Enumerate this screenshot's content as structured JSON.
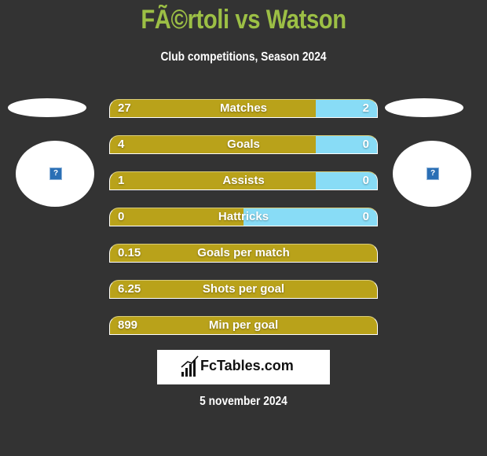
{
  "header": {
    "title": "FÃ©rtoli vs Watson",
    "subtitle": "Club competitions, Season 2024"
  },
  "players": {
    "left": {
      "logo_icon": "broken-image-icon"
    },
    "right": {
      "logo_icon": "broken-image-icon"
    }
  },
  "colors": {
    "title": "#9cbf45",
    "left_bar": "#b9a21a",
    "right_bar": "#88dcf6",
    "background": "#333333"
  },
  "stats": [
    {
      "label": "Matches",
      "left": "27",
      "right": "2",
      "left_share": 0.771
    },
    {
      "label": "Goals",
      "left": "4",
      "right": "0",
      "left_share": 0.771
    },
    {
      "label": "Assists",
      "left": "1",
      "right": "0",
      "left_share": 0.771
    },
    {
      "label": "Hattricks",
      "left": "0",
      "right": "0",
      "left_share": 0.5
    },
    {
      "label": "Goals per match",
      "left": "0.15",
      "right": null,
      "left_share": 1.0
    },
    {
      "label": "Shots per goal",
      "left": "6.25",
      "right": null,
      "left_share": 1.0
    },
    {
      "label": "Min per goal",
      "left": "899",
      "right": null,
      "left_share": 1.0
    }
  ],
  "brand": {
    "name": "FcTables.com"
  },
  "footer": {
    "date": "5 november 2024"
  }
}
